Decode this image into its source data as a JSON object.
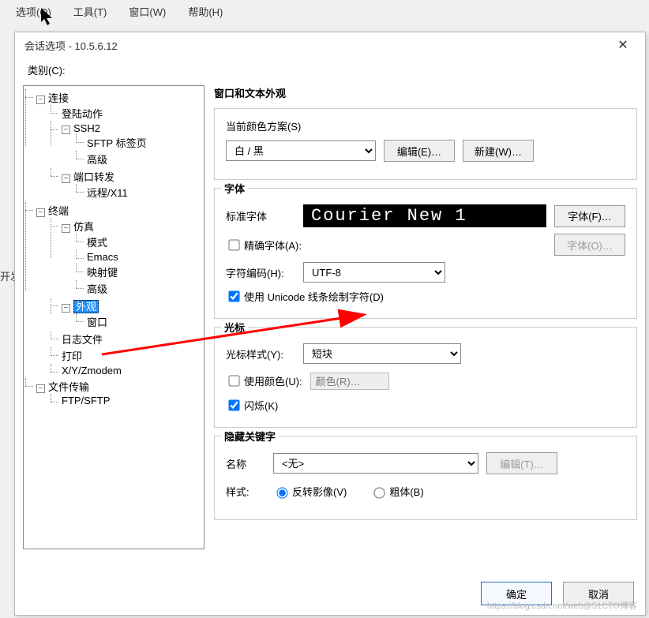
{
  "menubar": {
    "options": "选项(O)",
    "tools": "工具(T)",
    "window": "窗口(W)",
    "help": "帮助(H)"
  },
  "left_fragment": "开发",
  "dialog": {
    "title": "会话选项 - 10.5.6.12",
    "category_label": "类别(C):",
    "tree": {
      "conn": "连接",
      "login": "登陆动作",
      "ssh2": "SSH2",
      "sftp_tab": "SFTP 标签页",
      "adv1": "高级",
      "portfwd": "端口转发",
      "remote_x11": "远程/X11",
      "terminal": "终端",
      "emul": "仿真",
      "mode": "模式",
      "emacs": "Emacs",
      "mapkey": "映射键",
      "adv2": "高级",
      "appearance": "外观",
      "window": "窗口",
      "logfile": "日志文件",
      "print": "打印",
      "xyz": "X/Y/Zmodem",
      "filetrans": "文件传输",
      "ftpsftp": "FTP/SFTP"
    },
    "right": {
      "header": "窗口和文本外观",
      "scheme_label": "当前颜色方案(S)",
      "scheme_value": "白 / 黑",
      "edit_btn": "编辑(E)…",
      "new_btn": "新建(W)…",
      "font_group": "字体",
      "std_font": "标准字体",
      "font_preview": "Courier New 1",
      "font_btn": "字体(F)…",
      "exact_font": "精确字体(A):",
      "font_o_btn": "字体(O)…",
      "enc_label": "字符编码(H):",
      "enc_value": "UTF-8",
      "use_unicode": "使用 Unicode 线条绘制字符(D)",
      "cursor_group": "光标",
      "cursor_style_l": "光标样式(Y):",
      "cursor_style_v": "短块",
      "use_color": "使用颜色(U):",
      "color_swatch": "颜色(R)…",
      "blink": "闪烁(K)",
      "hide_group": "隐藏关键字",
      "name_l": "名称",
      "name_v": "<无>",
      "edit_t": "编辑(T)…",
      "style_l": "样式:",
      "inv_video": "反转影像(V)",
      "bold": "粗体(B)"
    },
    "footer": {
      "ok": "确定",
      "cancel": "取消"
    }
  },
  "watermark": "https://blog.csdn.net/web@51CTO博客"
}
